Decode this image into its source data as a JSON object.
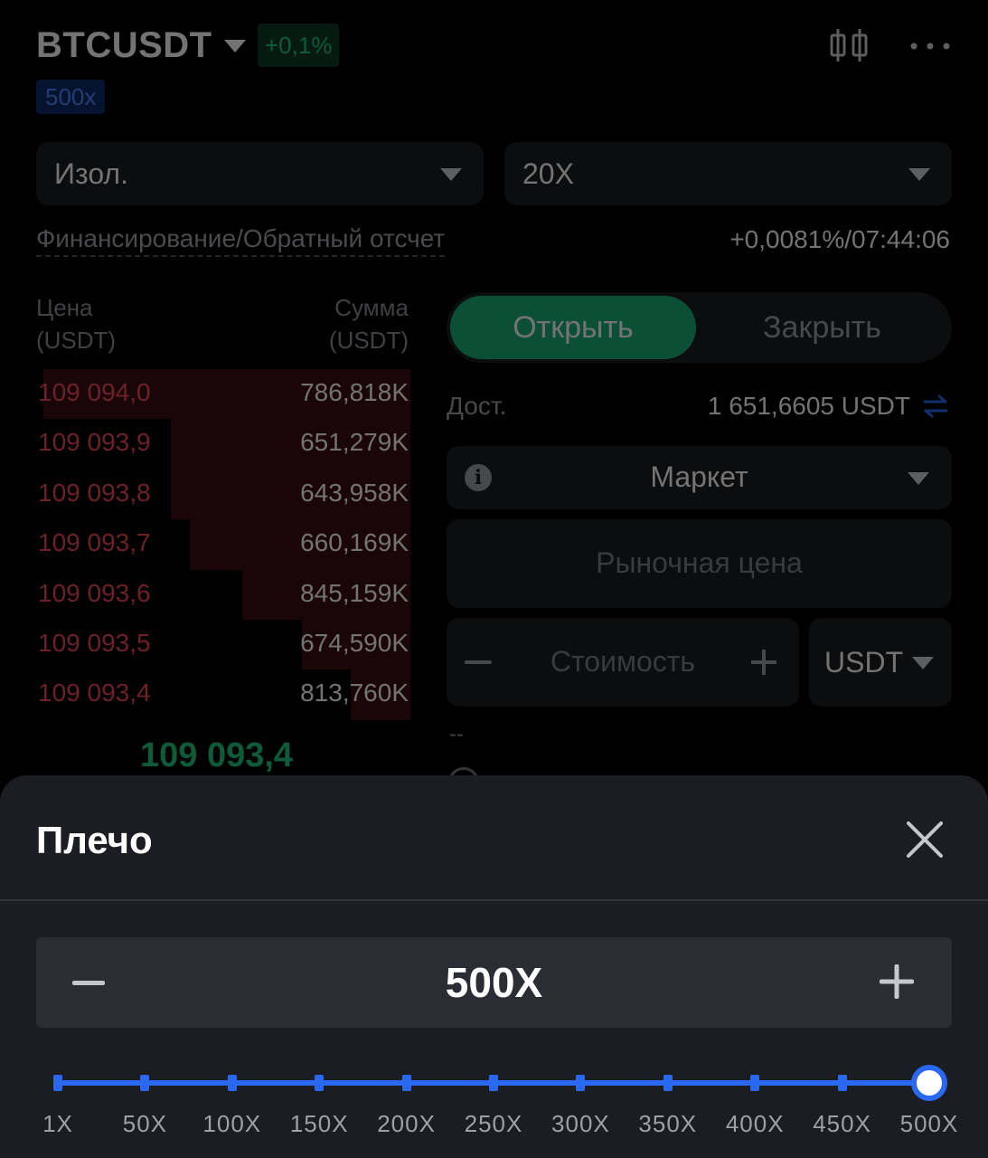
{
  "header": {
    "symbol": "BTCUSDT",
    "change": "+0,1%",
    "max_leverage_badge": "500x",
    "icons": [
      "candlestick-icon",
      "more-icon"
    ]
  },
  "margin_mode": {
    "value": "Изол."
  },
  "leverage_select": {
    "value": "20X"
  },
  "funding": {
    "label": "Финансирование/Обратный отсчет",
    "value": "+0,0081%/07:44:06"
  },
  "orderbook": {
    "price_header": "Цена",
    "price_unit": "(USDT)",
    "sum_header": "Сумма",
    "sum_unit": "(USDT)",
    "asks": [
      {
        "price": "109 094,0",
        "sum": "786,818K",
        "depth": 0.98
      },
      {
        "price": "109 093,9",
        "sum": "651,279K",
        "depth": 0.64
      },
      {
        "price": "109 093,8",
        "sum": "643,958K",
        "depth": 0.64
      },
      {
        "price": "109 093,7",
        "sum": "660,169K",
        "depth": 0.59
      },
      {
        "price": "109 093,6",
        "sum": "845,159K",
        "depth": 0.45
      },
      {
        "price": "109 093,5",
        "sum": "674,590K",
        "depth": 0.29
      },
      {
        "price": "109 093,4",
        "sum": "813,760K",
        "depth": 0.16
      }
    ],
    "last_price": "109 093,4"
  },
  "order_form": {
    "tab_open": "Открыть",
    "tab_close": "Закрыть",
    "available_label": "Дост.",
    "available_value": "1 651,6605 USDT",
    "order_type": "Маркет",
    "price_placeholder": "Рыночная цена",
    "amount_placeholder": "Стоимость",
    "unit": "USDT",
    "estimate": "--"
  },
  "leverage_sheet": {
    "title": "Плечо",
    "value": "500X",
    "slider_value_fraction": 1.0,
    "marks": [
      "1X",
      "50X",
      "100X",
      "150X",
      "200X",
      "250X",
      "300X",
      "350X",
      "400X",
      "450X",
      "500X"
    ]
  },
  "colors": {
    "up": "#1fc77e",
    "down": "#f04a5e",
    "accent": "#2969f2",
    "sheet_bg": "#1b1d22"
  }
}
